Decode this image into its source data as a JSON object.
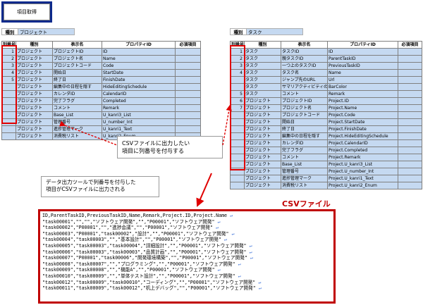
{
  "button": {
    "label": "項目取得"
  },
  "left_sheet": {
    "kind_label": "種別",
    "kind_value": "プロジェクト",
    "headers": [
      "列番号",
      "種別",
      "表示名",
      "プロパティID",
      "必須項目"
    ],
    "rows": [
      {
        "n": "1",
        "kind": "プロジェクト",
        "name": "プロジェクトID",
        "prop": "ID"
      },
      {
        "n": "2",
        "kind": "プロジェクト",
        "name": "プロジェクト名",
        "prop": "Name"
      },
      {
        "n": "3",
        "kind": "プロジェクト",
        "name": "プロジェクトコード",
        "prop": "Code"
      },
      {
        "n": "4",
        "kind": "プロジェクト",
        "name": "開始日",
        "prop": "StartDate"
      },
      {
        "n": "5",
        "kind": "プロジェクト",
        "name": "終了日",
        "prop": "FinishDate"
      },
      {
        "n": "",
        "kind": "プロジェクト",
        "name": "編集中の日程を隠す",
        "prop": "HideEditingSchedule"
      },
      {
        "n": "",
        "kind": "プロジェクト",
        "name": "カレンダID",
        "prop": "CalendarID"
      },
      {
        "n": "",
        "kind": "プロジェクト",
        "name": "完了フラグ",
        "prop": "Completed"
      },
      {
        "n": "",
        "kind": "プロジェクト",
        "name": "コメント",
        "prop": "Remark"
      },
      {
        "n": "",
        "kind": "プロジェクト",
        "name": "Base_List",
        "prop": "U_kanri3_List"
      },
      {
        "n": "",
        "kind": "プロジェクト",
        "name": "管理番号",
        "prop": "U_number_Int"
      },
      {
        "n": "",
        "kind": "プロジェクト",
        "name": "進捗管理マーク",
        "prop": "U_kanri1_Text"
      },
      {
        "n": "",
        "kind": "プロジェクト",
        "name": "消費税リスト",
        "prop": "U_kanri2_Enum"
      }
    ]
  },
  "right_sheet": {
    "kind_label": "種別",
    "kind_value": "タスク",
    "headers": [
      "列番号",
      "種別",
      "表示名",
      "プロパティID",
      "必須項目"
    ],
    "rows": [
      {
        "n": "1",
        "kind": "タスク",
        "name": "タスクID",
        "prop": "ID"
      },
      {
        "n": "2",
        "kind": "タスク",
        "name": "親タスクID",
        "prop": "ParentTaskID"
      },
      {
        "n": "3",
        "kind": "タスク",
        "name": "一つ上のタスクID",
        "prop": "PreviousTaskID"
      },
      {
        "n": "4",
        "kind": "タスク",
        "name": "タスク名",
        "prop": "Name"
      },
      {
        "n": "",
        "kind": "タスク",
        "name": "ジャンプ先のURL",
        "prop": "Url"
      },
      {
        "n": "",
        "kind": "タスク",
        "name": "サマリアクティビティのバー",
        "prop": "BarColor"
      },
      {
        "n": "5",
        "kind": "タスク",
        "name": "コメント",
        "prop": "Remark"
      },
      {
        "n": "6",
        "kind": "プロジェクト",
        "name": "プロジェクトID",
        "prop": "Project.ID"
      },
      {
        "n": "7",
        "kind": "プロジェクト",
        "name": "プロジェクト名",
        "prop": "Project.Name"
      },
      {
        "n": "",
        "kind": "プロジェクト",
        "name": "プロジェクトコード",
        "prop": "Project.Code"
      },
      {
        "n": "",
        "kind": "プロジェクト",
        "name": "開始日",
        "prop": "Project.StartDate"
      },
      {
        "n": "",
        "kind": "プロジェクト",
        "name": "終了日",
        "prop": "Project.FinishDate"
      },
      {
        "n": "",
        "kind": "プロジェクト",
        "name": "編集中の日程を隠す",
        "prop": "Project.HideEditingSchedule"
      },
      {
        "n": "",
        "kind": "プロジェクト",
        "name": "カレンダID",
        "prop": "Project.CalendarID"
      },
      {
        "n": "",
        "kind": "プロジェクト",
        "name": "完了フラグ",
        "prop": "Project.Completed"
      },
      {
        "n": "",
        "kind": "プロジェクト",
        "name": "コメント",
        "prop": "Project.Remark"
      },
      {
        "n": "",
        "kind": "プロジェクト",
        "name": "Base_List",
        "prop": "Project.U_kanri3_List"
      },
      {
        "n": "",
        "kind": "プロジェクト",
        "name": "管理番号",
        "prop": "Project.U_number_Int"
      },
      {
        "n": "",
        "kind": "プロジェクト",
        "name": "進捗管理マーク",
        "prop": "Project.U_kanri1_Text"
      },
      {
        "n": "",
        "kind": "プロジェクト",
        "name": "消費税リスト",
        "prop": "Project.U_kanri2_Enum"
      }
    ]
  },
  "annotation_center": [
    "CSVファイルに出力したい",
    "項目に列番号を付与する"
  ],
  "annotation_left": [
    "データ出力ツールで列番号を付与した",
    "項目がCSVファイルに出力される"
  ],
  "csv_title": "CSVファイル",
  "csv_lines": [
    "ID,ParentTaskID,PreviousTaskID,Name,Remark,Project.ID,Project.Name",
    "\"task00001\",\"\",\"\",\"ソフトウェア開発\",\"\",\"P00001\",\"ソフトウェア開発\"",
    "\"task00002\",\"P00001\",\"\",\"進捗会議\",\"\",\"P00001\",\"ソフトウェア開発\"",
    "\"task00003\",\"P00001\",\"task00002\",\"設計\",\"\",\"P00001\",\"ソフトウェア開発\"",
    "\"task00004\",\"task00003\",\"\",\"基本設計\",\"\",\"P00001\",\"ソフトウェア開発\"",
    "\"task00005\",\"task00003\",\"task00004\",\"詳細設計\",\"\",\"P00001\",\"ソフトウェア開発\"",
    "\"task00006\",\"task00003\",\"task00003\",\"品質計画\",\"\",\"P00001\",\"ソフトウェア開発\"",
    "\"task00007\",\"P00001\",\"task00006\",\"開発環境構築\",\"\",\"P00001\",\"ソフトウェア開発\"",
    "\"task00008\",\"task00007\",\"\",\"プログラミング\",\"\",\"P00001\",\"ソフトウェア開発\"",
    "\"task00009\",\"task00008\",\"\",\"機能A\",\"\",\"P00001\",\"ソフトウェア開発\"",
    "\"task00010\",\"task00009\",\"\",\"単体テスト設計\",\"\",\"P00001\",\"ソフトウェア開発\"",
    "\"task00012\",\"task00009\",\"task00010\",\"コーディング\",\"\",\"P00001\",\"ソフトウェア開発\"",
    "\"task00011\",\"task00009\",\"task00012\",\"机上デバッグ\",\"\",\"P00001\",\"ソフトウェア開発\""
  ],
  "colors": {
    "accent_red": "#e00000",
    "button_frame": "#0d2a8c",
    "cell_blue": "#c5d9f1"
  }
}
